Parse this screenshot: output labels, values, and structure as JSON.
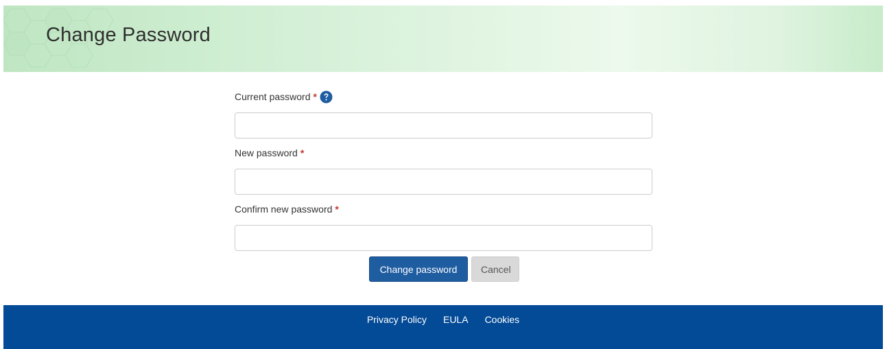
{
  "header": {
    "title": "Change Password"
  },
  "form": {
    "fields": [
      {
        "label": "Current password",
        "required_marker": "*",
        "help_icon": "question-circle-icon",
        "value": "",
        "placeholder": ""
      },
      {
        "label": "New password",
        "required_marker": "*",
        "value": "",
        "placeholder": ""
      },
      {
        "label": "Confirm new password",
        "required_marker": "*",
        "value": "",
        "placeholder": ""
      }
    ],
    "submit_label": "Change password",
    "cancel_label": "Cancel"
  },
  "footer": {
    "links": [
      "Privacy Policy",
      "EULA",
      "Cookies"
    ]
  },
  "colors": {
    "primary": "#1f5da1",
    "footer": "#034a97",
    "required": "#c0392b",
    "header_tint": "#cfeed2"
  }
}
